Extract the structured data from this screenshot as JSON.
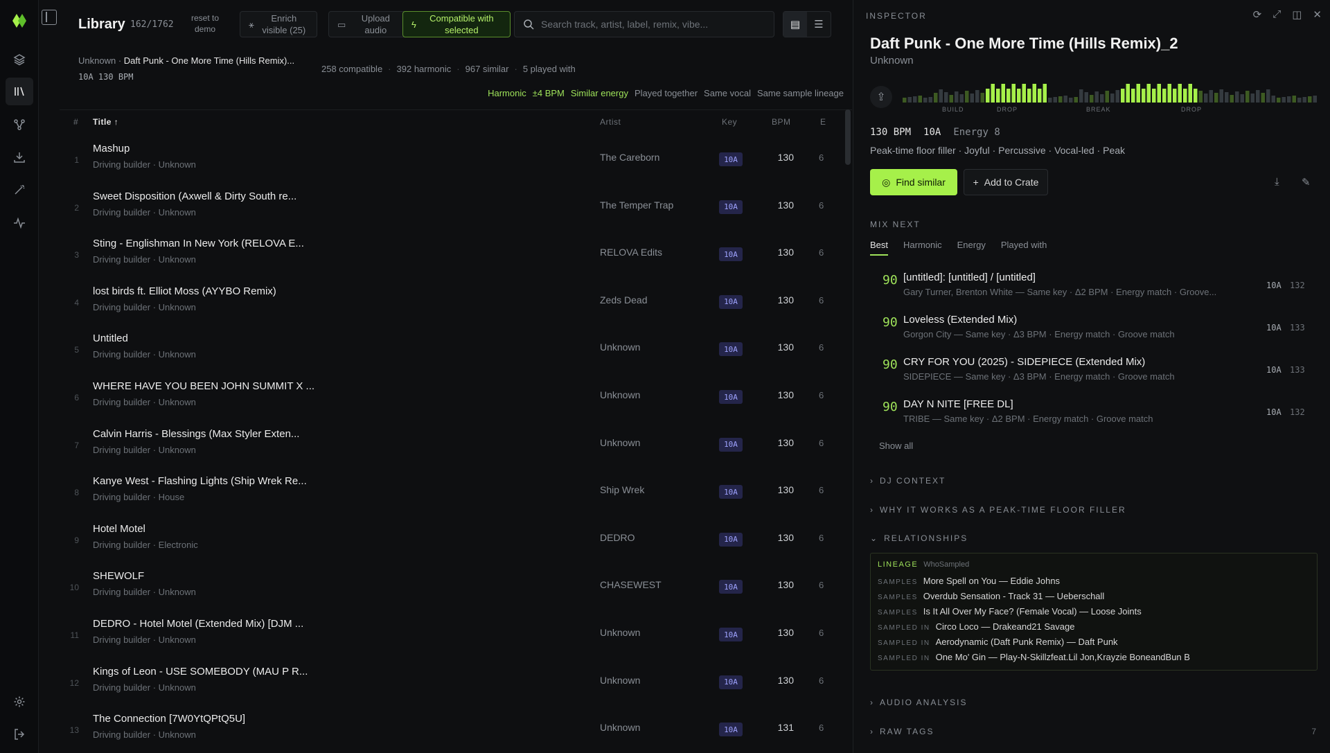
{
  "library": {
    "title": "Library",
    "count": "162/1762",
    "reset_label": "reset to demo",
    "enrich_label": "Enrich visible (25)",
    "upload_label": "Upload audio",
    "compatible_label": "Compatible with selected",
    "search_placeholder": "Search track, artist, label, remix, vibe...",
    "selected_artist": "Unknown",
    "selected_sep": "·",
    "selected_title": "Daft Punk - One More Time (Hills Remix)...",
    "selected_key": "10A",
    "selected_bpm": "130 BPM",
    "stats": [
      "258 compatible",
      "392 harmonic",
      "967 similar",
      "5 played with"
    ],
    "filters": [
      {
        "label": "Harmonic",
        "active": true
      },
      {
        "label": "±4 BPM",
        "active": true
      },
      {
        "label": "Similar energy",
        "active": true
      },
      {
        "label": "Played together",
        "active": false
      },
      {
        "label": "Same vocal",
        "active": false
      },
      {
        "label": "Same sample lineage",
        "active": false
      }
    ],
    "columns": {
      "num": "#",
      "title": "Title",
      "artist": "Artist",
      "key": "Key",
      "bpm": "BPM",
      "energy": "E"
    },
    "rows": [
      {
        "n": "1",
        "title": "Mashup",
        "sub": "Driving builder · Unknown",
        "artist": "The Careborn",
        "key": "10A",
        "bpm": "130",
        "e": "6"
      },
      {
        "n": "2",
        "title": "Sweet Disposition (Axwell & Dirty South re...",
        "sub": "Driving builder · Unknown",
        "artist": "The Temper Trap",
        "key": "10A",
        "bpm": "130",
        "e": "6"
      },
      {
        "n": "3",
        "title": "Sting - Englishman In New York (RELOVA E...",
        "sub": "Driving builder · Unknown",
        "artist": "RELOVA Edits",
        "key": "10A",
        "bpm": "130",
        "e": "6"
      },
      {
        "n": "4",
        "title": "lost birds ft. Elliot Moss (AYYBO Remix)",
        "sub": "Driving builder · Unknown",
        "artist": "Zeds Dead",
        "key": "10A",
        "bpm": "130",
        "e": "6"
      },
      {
        "n": "5",
        "title": "Untitled",
        "sub": "Driving builder · Unknown",
        "artist": "Unknown",
        "key": "10A",
        "bpm": "130",
        "e": "6"
      },
      {
        "n": "6",
        "title": "WHERE HAVE YOU BEEN JOHN SUMMIT X ...",
        "sub": "Driving builder · Unknown",
        "artist": "Unknown",
        "key": "10A",
        "bpm": "130",
        "e": "6"
      },
      {
        "n": "7",
        "title": "Calvin Harris - Blessings (Max Styler Exten...",
        "sub": "Driving builder · Unknown",
        "artist": "Unknown",
        "key": "10A",
        "bpm": "130",
        "e": "6"
      },
      {
        "n": "8",
        "title": "Kanye West - Flashing Lights (Ship Wrek Re...",
        "sub": "Driving builder · House",
        "artist": "Ship Wrek",
        "key": "10A",
        "bpm": "130",
        "e": "6"
      },
      {
        "n": "9",
        "title": "Hotel Motel",
        "sub": "Driving builder · Electronic",
        "artist": "DEDRO",
        "key": "10A",
        "bpm": "130",
        "e": "6"
      },
      {
        "n": "10",
        "title": "SHEWOLF",
        "sub": "Driving builder · Unknown",
        "artist": "CHASEWEST",
        "key": "10A",
        "bpm": "130",
        "e": "6"
      },
      {
        "n": "11",
        "title": "DEDRO - Hotel Motel (Extended Mix) [DJM ...",
        "sub": "Driving builder · Unknown",
        "artist": "Unknown",
        "key": "10A",
        "bpm": "130",
        "e": "6"
      },
      {
        "n": "12",
        "title": "Kings of Leon - USE SOMEBODY (MAU P R...",
        "sub": "Driving builder · Unknown",
        "artist": "Unknown",
        "key": "10A",
        "bpm": "130",
        "e": "6"
      },
      {
        "n": "13",
        "title": "The Connection [7W0YtQPtQ5U]",
        "sub": "Driving builder · Unknown",
        "artist": "Unknown",
        "key": "10A",
        "bpm": "131",
        "e": "6"
      }
    ]
  },
  "inspector": {
    "label": "INSPECTOR",
    "title": "Daft Punk - One More Time (Hills Remix)_2",
    "artist": "Unknown",
    "waveform_sections": [
      "BUILD",
      "DROP",
      "BREAK",
      "DROP"
    ],
    "bpm": "130 BPM",
    "key": "10A",
    "energy": "Energy 8",
    "tags": "Peak-time floor filler · Joyful · Percussive · Vocal-led · Peak",
    "find_similar": "Find similar",
    "add_to_crate": "Add to Crate",
    "mix_next_label": "MIX NEXT",
    "mix_tabs": [
      "Best",
      "Harmonic",
      "Energy",
      "Played with"
    ],
    "mix_next": [
      {
        "score": "90",
        "title": "[untitled]: [untitled] / [untitled]",
        "sub": "Gary Turner, Brenton White — Same key · Δ2 BPM · Energy match · Groove...",
        "key": "10A",
        "bpm": "132"
      },
      {
        "score": "90",
        "title": "Loveless (Extended Mix)",
        "sub": "Gorgon City — Same key · Δ3 BPM · Energy match · Groove match",
        "key": "10A",
        "bpm": "133"
      },
      {
        "score": "90",
        "title": "CRY FOR YOU (2025) - SIDEPIECE (Extended Mix)",
        "sub": "SIDEPIECE — Same key · Δ3 BPM · Energy match · Groove match",
        "key": "10A",
        "bpm": "133"
      },
      {
        "score": "90",
        "title": "DAY N NITE [FREE DL]",
        "sub": "TRIBE — Same key · Δ2 BPM · Energy match · Groove match",
        "key": "10A",
        "bpm": "132"
      }
    ],
    "show_all": "Show all",
    "sections": {
      "dj_context": "DJ CONTEXT",
      "why_it_works": "WHY IT WORKS AS A PEAK-TIME FLOOR FILLER",
      "relationships": "RELATIONSHIPS",
      "audio_analysis": "AUDIO ANALYSIS",
      "raw_tags": "RAW TAGS",
      "raw_tags_count": "7"
    },
    "lineage": {
      "label": "LINEAGE",
      "source": "WhoSampled",
      "rows": [
        {
          "kind": "SAMPLES",
          "text": "More Spell on You — Eddie Johns"
        },
        {
          "kind": "SAMPLES",
          "text": "Overdub Sensation - Track 31 — Ueberschall"
        },
        {
          "kind": "SAMPLES",
          "text": "Is It All Over My Face? (Female Vocal) — Loose Joints"
        },
        {
          "kind": "SAMPLED IN",
          "text": "Circo Loco — Drakeand21 Savage"
        },
        {
          "kind": "SAMPLED IN",
          "text": "Aerodynamic (Daft Punk Remix) — Daft Punk"
        },
        {
          "kind": "SAMPLED IN",
          "text": "One Mo' Gin — Play-N-Skillzfeat.Lil Jon,Krayzie BoneandBun B"
        }
      ]
    }
  },
  "colors": {
    "accent": "#a6f04a",
    "key_badge_bg": "#24254a",
    "key_badge_fg": "#9fa3ff"
  }
}
